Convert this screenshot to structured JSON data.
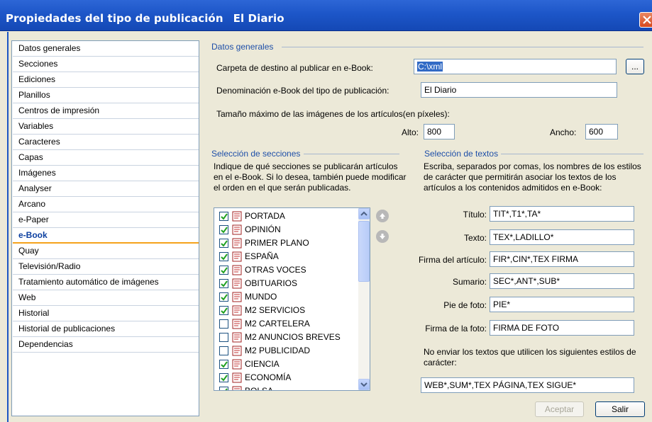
{
  "window": {
    "title": "Propiedades del tipo de publicación",
    "subtitle": "El Diario"
  },
  "nav": {
    "items": [
      {
        "label": "Datos generales"
      },
      {
        "label": "Secciones"
      },
      {
        "label": "Ediciones"
      },
      {
        "label": "Planillos"
      },
      {
        "label": "Centros de impresión"
      },
      {
        "label": "Variables"
      },
      {
        "label": "Caracteres"
      },
      {
        "label": "Capas"
      },
      {
        "label": "Imágenes"
      },
      {
        "label": "Analyser"
      },
      {
        "label": "Arcano"
      },
      {
        "label": "e-Paper"
      },
      {
        "label": "e-Book",
        "active": true
      },
      {
        "label": "Quay"
      },
      {
        "label": "Televisión/Radio"
      },
      {
        "label": "Tratamiento automático de imágenes"
      },
      {
        "label": "Web"
      },
      {
        "label": "Historial"
      },
      {
        "label": "Historial de publicaciones"
      },
      {
        "label": "Dependencias"
      }
    ]
  },
  "general": {
    "header": "Datos generales",
    "dest_label": "Carpeta de destino al publicar en e-Book:",
    "dest_value": "C:\\xml",
    "browse_label": "...",
    "name_label": "Denominación e-Book del tipo de publicación:",
    "name_value": "El Diario",
    "maxsize_label": "Tamaño máximo de las imágenes de los artículos(en píxeles):",
    "alto_label": "Alto:",
    "alto_value": "800",
    "ancho_label": "Ancho:",
    "ancho_value": "600"
  },
  "sections": {
    "header": "Selección de secciones",
    "desc1": "Indique de qué secciones se publicarán artículos",
    "desc2": "en el e-Book. Si lo desea, también puede modificar",
    "desc3": "el orden en el que serán publicadas.",
    "items": [
      {
        "label": "PORTADA",
        "checked": true
      },
      {
        "label": "OPINIÓN",
        "checked": true
      },
      {
        "label": "PRIMER PLANO",
        "checked": true
      },
      {
        "label": "ESPAÑA",
        "checked": true
      },
      {
        "label": "OTRAS VOCES",
        "checked": true
      },
      {
        "label": "OBITUARIOS",
        "checked": true
      },
      {
        "label": "MUNDO",
        "checked": true
      },
      {
        "label": "M2 SERVICIOS",
        "checked": true
      },
      {
        "label": "M2 CARTELERA",
        "checked": false
      },
      {
        "label": "M2 ANUNCIOS BREVES",
        "checked": false
      },
      {
        "label": "M2 PUBLICIDAD",
        "checked": false
      },
      {
        "label": "CIENCIA",
        "checked": true
      },
      {
        "label": "ECONOMÍA",
        "checked": true
      },
      {
        "label": "BOLSA",
        "checked": true
      }
    ]
  },
  "texts": {
    "header": "Selección de textos",
    "desc1": "Escriba, separados por comas, los nombres de los estilos",
    "desc2": "de carácter que permitirán asociar los textos de los",
    "desc3": "artículos a los contenidos admitidos en e-Book:",
    "fields": [
      {
        "label": "Título:",
        "value": "TIT*,T1*,TA*"
      },
      {
        "label": "Texto:",
        "value": "TEX*,LADILLO*"
      },
      {
        "label": "Firma del artículo:",
        "value": "FIR*,CIN*,TEX FIRMA"
      },
      {
        "label": "Sumario:",
        "value": "SEC*,ANT*,SUB*"
      },
      {
        "label": "Pie de foto:",
        "value": "PIE*"
      },
      {
        "label": "Firma de la foto:",
        "value": "FIRMA DE FOTO"
      }
    ],
    "exclude_desc1": "No enviar los textos que utilicen los siguientes estilos de",
    "exclude_desc2": "carácter:",
    "exclude_value": "WEB*,SUM*,TEX PÁGINA,TEX SIGUE*"
  },
  "footer": {
    "accept_label": "Aceptar",
    "exit_label": "Salir"
  }
}
